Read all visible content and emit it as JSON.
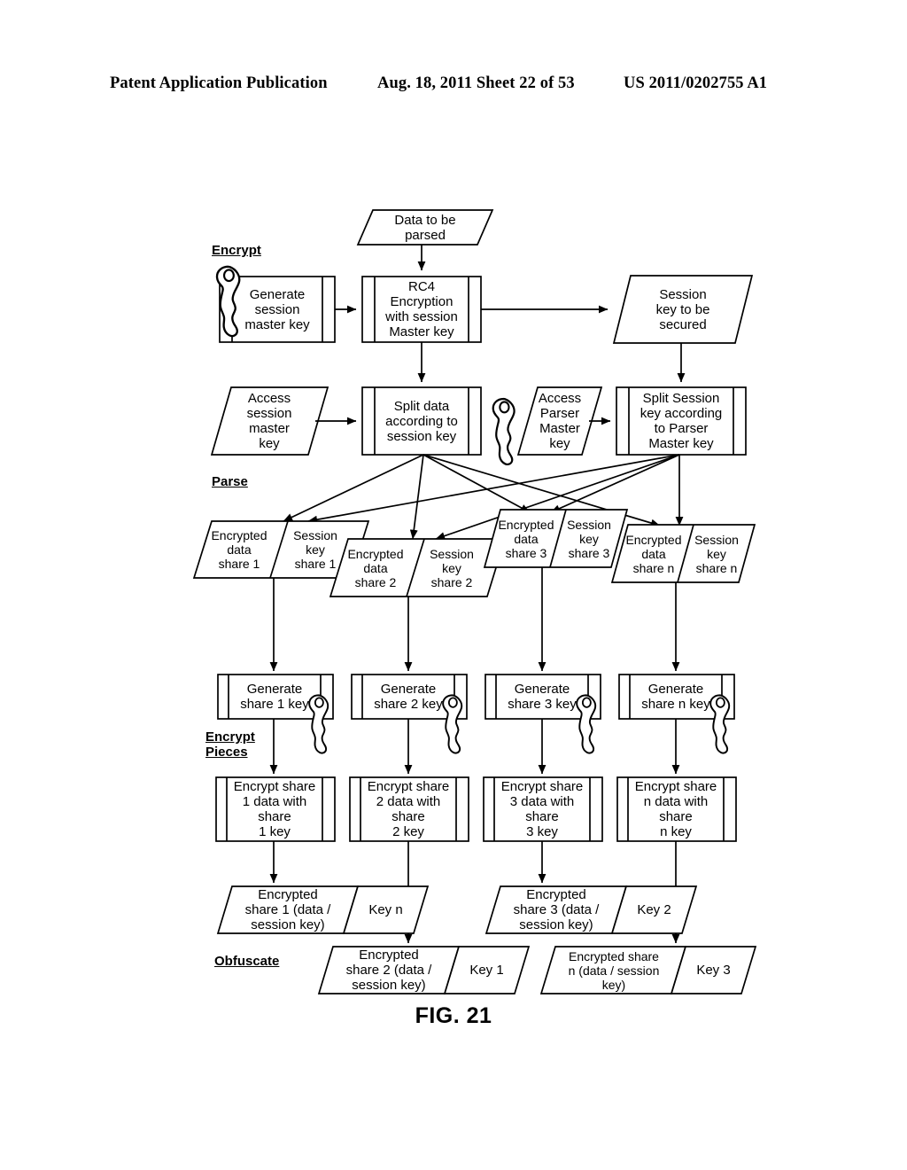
{
  "header": {
    "publication": "Patent Application Publication",
    "date_sheet": "Aug. 18, 2011  Sheet 22 of 53",
    "patent_number": "US 2011/0202755 A1"
  },
  "figure": {
    "caption": "FIG. 21"
  },
  "sections": [
    {
      "id": "encrypt",
      "lines": [
        "Encrypt"
      ]
    },
    {
      "id": "parse",
      "lines": [
        "Parse"
      ]
    },
    {
      "id": "encrypt-pieces",
      "lines": [
        "Encrypt",
        "Pieces"
      ]
    },
    {
      "id": "obfuscate",
      "lines": [
        "Obfuscate"
      ]
    }
  ],
  "nodes": {
    "data_to_be_parsed": "Data to be\nparsed",
    "generate_session_master_key": "Generate\nsession\nmaster key",
    "rc4_encryption": "RC4\nEncryption\nwith session\nMaster key",
    "session_key_to_be_secured": "Session\nkey to be\nsecured",
    "access_session_master_key": "Access\nsession\nmaster\nkey",
    "split_data": "Split data\naccording to\nsession key",
    "access_parser_master_key": "Access\nParser\nMaster\nkey",
    "split_session_key": "Split Session\nkey according\nto Parser\nMaster key"
  },
  "shares": [
    {
      "data": "Encrypted\ndata\nshare 1",
      "key": "Session\nkey\nshare 1",
      "generate": "Generate\nshare 1 key",
      "encrypt": "Encrypt share\n1 data with\nshare\n1 key",
      "output": "Encrypted\nshare 1 (data /\nsession key)",
      "output_key": "Key n"
    },
    {
      "data": "Encrypted\ndata\nshare 2",
      "key": "Session\nkey\nshare 2",
      "generate": "Generate\nshare 2 key",
      "encrypt": "Encrypt share\n2 data with\nshare\n2 key",
      "output": "Encrypted\nshare 2 (data /\nsession key)",
      "output_key": "Key 1"
    },
    {
      "data": "Encrypted\ndata\nshare 3",
      "key": "Session\nkey\nshare 3",
      "generate": "Generate\nshare 3 key",
      "encrypt": "Encrypt share\n3 data with\nshare\n3 key",
      "output": "Encrypted\nshare 3 (data /\nsession key)",
      "output_key": "Key 2"
    },
    {
      "data": "Encrypted\ndata\nshare n",
      "key": "Session\nkey\nshare n",
      "generate": "Generate\nshare n key",
      "encrypt": "Encrypt share\nn data with\nshare\nn key",
      "output": "Encrypted share\nn (data / session\nkey)",
      "output_key": "Key 3"
    }
  ],
  "icons": {
    "key_icon_name": "key-icon"
  },
  "colors": {
    "line": "#000000",
    "background": "#ffffff"
  }
}
